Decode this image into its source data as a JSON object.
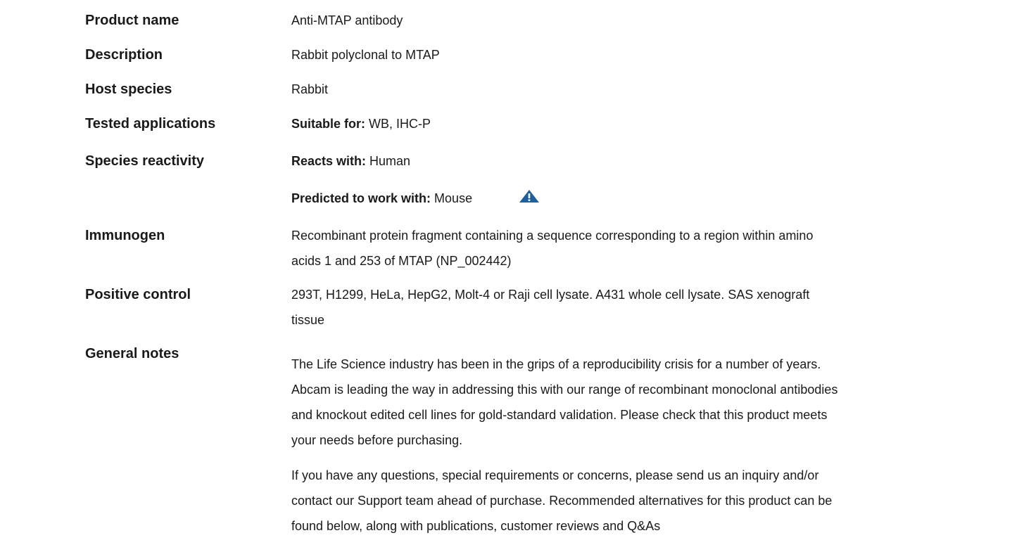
{
  "rows": {
    "product_name": {
      "label": "Product name",
      "value": "Anti-MTAP antibody"
    },
    "description": {
      "label": "Description",
      "value": "Rabbit polyclonal to MTAP"
    },
    "host_species": {
      "label": "Host species",
      "value": "Rabbit"
    },
    "tested_applications": {
      "label": "Tested applications",
      "prefix": "Suitable for:",
      "value": "WB, IHC-P"
    },
    "species_reactivity": {
      "label": "Species reactivity",
      "reacts_prefix": "Reacts with:",
      "reacts_value": "Human",
      "predicted_prefix": "Predicted to work with:",
      "predicted_value": "Mouse",
      "predicted_icon": "warning-triangle-icon"
    },
    "immunogen": {
      "label": "Immunogen",
      "line1": "Recombinant protein fragment containing a sequence corresponding to a region within amino",
      "line2": "acids 1 and 253 of MTAP (NP_002442)"
    },
    "positive_control": {
      "label": "Positive control",
      "line1": "293T, H1299, HeLa, HepG2, Molt-4 or Raji cell lysate. A431 whole cell lysate. SAS xenograft",
      "line2": "tissue"
    },
    "general_notes": {
      "label": "General notes",
      "para1": [
        "The Life Science industry has been in the grips of a reproducibility crisis for a number of years.",
        "Abcam is leading the way in addressing this with our range of recombinant monoclonal antibodies",
        "and knockout edited cell lines for gold-standard validation. Please check that this product meets",
        "your needs before purchasing."
      ],
      "para2": [
        "If you have any questions, special requirements or concerns, please send us an inquiry and/or",
        "contact our Support team ahead of purchase. Recommended alternatives for this product can be",
        "found below, along with publications, customer reviews and Q&As"
      ]
    }
  },
  "colors": {
    "text": "#1a1a1a",
    "icon": "#1f5f9e"
  }
}
